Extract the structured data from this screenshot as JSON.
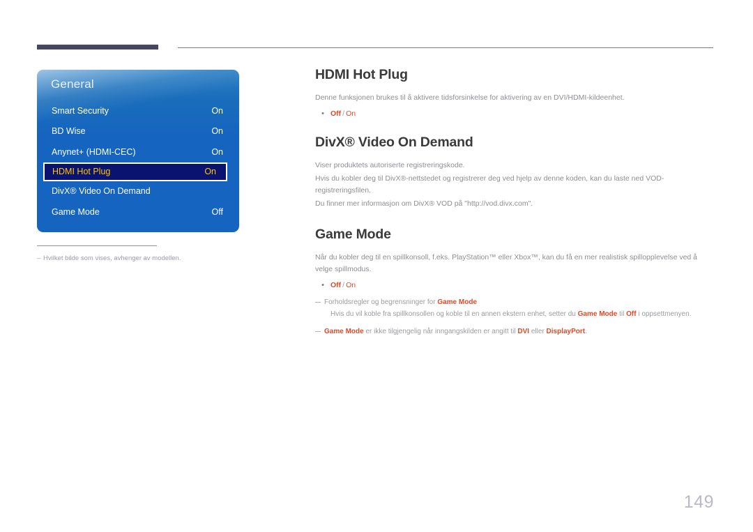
{
  "osd": {
    "title": "General",
    "rows": [
      {
        "label": "Smart Security",
        "value": "On",
        "selected": false
      },
      {
        "label": "BD Wise",
        "value": "On",
        "selected": false
      },
      {
        "label": "Anynet+ (HDMI-CEC)",
        "value": "On",
        "selected": false
      },
      {
        "label": "HDMI Hot Plug",
        "value": "On",
        "selected": true
      },
      {
        "label": "DivX® Video On Demand",
        "value": "",
        "selected": false
      },
      {
        "label": "Game Mode",
        "value": "Off",
        "selected": false
      }
    ]
  },
  "footnote": {
    "dash": "–",
    "text": "Hvilket bilde som vises, avhenger av modellen."
  },
  "sections": {
    "hdmi_hot_plug": {
      "title": "HDMI Hot Plug",
      "body": "Denne funksjonen brukes til å aktivere tidsforsinkelse for aktivering av en DVI/HDMI-kildeenhet.",
      "bullet_dot": "•",
      "option_off": "Off",
      "option_sep": "/",
      "option_on": "On"
    },
    "divx": {
      "title": "DivX® Video On Demand",
      "body1": "Viser produktets autoriserte registreringskode.",
      "body2": "Hvis du kobler deg til DivX®-nettstedet og registrerer deg ved hjelp av denne koden, kan du laste ned VOD-registreringsfilen.",
      "body3": "Du finner mer informasjon om DivX® VOD på \"http://vod.divx.com\"."
    },
    "game_mode": {
      "title": "Game Mode",
      "body": "Når du kobler deg til en spillkonsoll, f.eks. PlayStation™ eller Xbox™, kan du få en mer realistisk spillopplevelse ved å velge spillmodus.",
      "bullet_dot": "•",
      "option_off": "Off",
      "option_sep": "/",
      "option_on": "On",
      "note1_pre": "Forholdsregler og begrensninger for ",
      "note1_hl": "Game Mode",
      "note2_pre": "Hvis du  vil koble fra spillkonsollen og koble til en annen ekstern enhet, setter du ",
      "note2_hl1": "Game Mode",
      "note2_mid": " til ",
      "note2_hl2": "Off",
      "note2_post": " i oppsettmenyen.",
      "note3_hl1": "Game Mode",
      "note3_mid": " er ikke tilgjengelig når inngangskilden er angitt til ",
      "note3_hl2": "DVI",
      "note3_mid2": " eller ",
      "note3_hl3": "DisplayPort",
      "note3_post": "."
    }
  },
  "page_number": "149",
  "colors": {
    "accent_orange": "#df4a26",
    "osd_blue": "#1565c0",
    "osd_selected_bg": "#0a1470",
    "osd_selected_text": "#ffc400",
    "heading": "#3a3a3a",
    "body_gray": "#8e8e94",
    "page_num": "#b9b9cc",
    "top_bar": "#46465f"
  }
}
